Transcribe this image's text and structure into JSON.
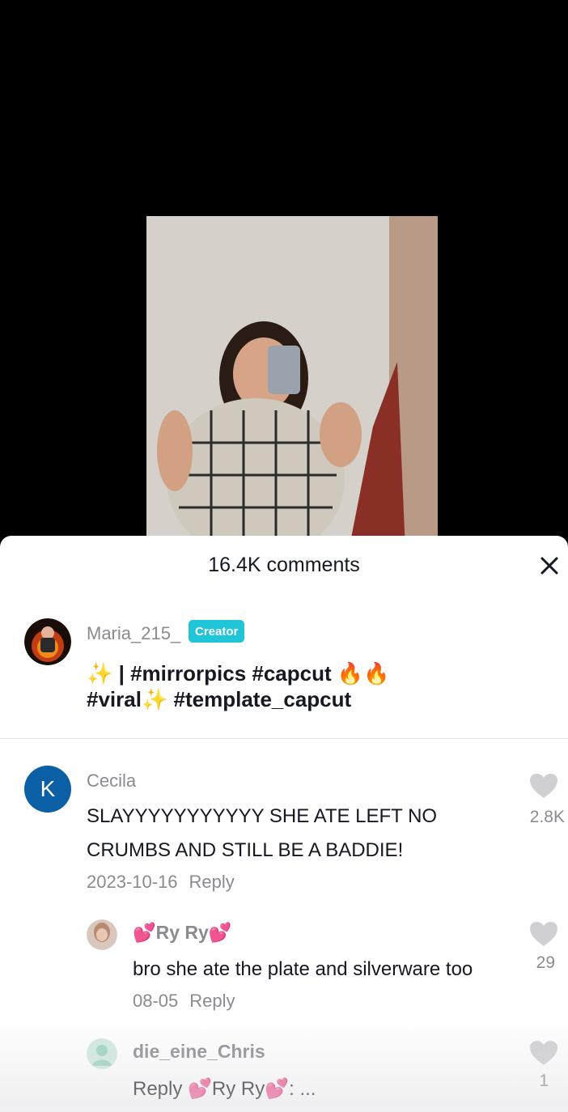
{
  "header": {
    "comment_count": "16.4K comments"
  },
  "caption": {
    "username": "Maria_215_",
    "badge": "Creator",
    "line1": "✨ | #mirrorpics #capcut 🔥🔥",
    "line2": "#viral✨ #template_capcut"
  },
  "comments": [
    {
      "username": "Cecila",
      "avatar_letter": "K",
      "line1": "SLAYYYYYYYYYYY SHE ATE LEFT NO",
      "line2": "CRUMBS AND STILL BE A BADDIE!",
      "date": "2023-10-16",
      "reply_label": "Reply",
      "likes": "2.8K"
    }
  ],
  "replies": [
    {
      "username": "💕Ry Ry💕",
      "text": "bro she ate the plate and silverware too",
      "date": "08-05",
      "reply_label": "Reply",
      "likes": "29"
    },
    {
      "username": "die_eine_Chris",
      "text": "Reply 💕Ry Ry💕: ...",
      "likes": "1"
    }
  ],
  "colors": {
    "badge": "#20c5d8",
    "avatar_k": "#0b5fa5",
    "muted_text": "#8a8b91",
    "primary_text": "#161823"
  }
}
